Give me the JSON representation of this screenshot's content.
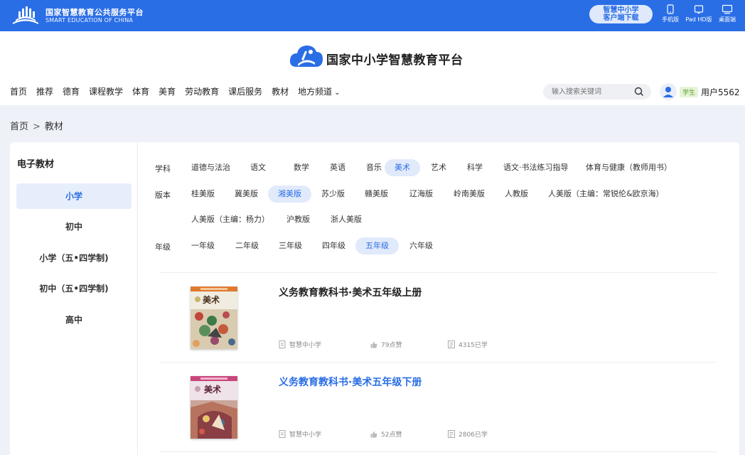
{
  "topbar": {
    "brand_cn": "国家智慧教育公共服务平台",
    "brand_en": "SMART EDUCATION OF CHINA",
    "download_line1": "智慧中小学",
    "download_line2": "客户端下载",
    "devices": [
      {
        "label": "手机版",
        "icon": "mobile-icon"
      },
      {
        "label": "Pad HD版",
        "icon": "tablet-icon"
      },
      {
        "label": "桌面端",
        "icon": "desktop-icon"
      }
    ]
  },
  "header": {
    "site_title": "国家中小学智慧教育平台",
    "nav": [
      "首页",
      "推荐",
      "德育",
      "课程教学",
      "体育",
      "美育",
      "劳动教育",
      "课后服务",
      "教材",
      "地方频道"
    ],
    "search_placeholder": "输入搜索关键词",
    "user_role": "学生",
    "user_name": "用户5562"
  },
  "breadcrumb": {
    "home": "首页",
    "sep": ">",
    "current": "教材"
  },
  "sidebar": {
    "title": "电子教材",
    "items": [
      "小学",
      "初中",
      "小学（五•四学制)",
      "初中（五•四学制)",
      "高中"
    ],
    "active_index": 0
  },
  "filters": {
    "subject": {
      "label": "学科",
      "options": [
        "道德与法治",
        "语文",
        "数学",
        "英语",
        "音乐",
        "美术",
        "艺术",
        "科学",
        "语文·书法练习指导",
        "体育与健康（教师用书）"
      ],
      "selected": "美术"
    },
    "edition": {
      "label": "版本",
      "options": [
        "桂美版",
        "冀美版",
        "湘美版",
        "苏少版",
        "赣美版",
        "辽海版",
        "岭南美版",
        "人教版",
        "人美版（主编：常锐伦&欧京海）",
        "人美版（主编：杨力）",
        "沪教版",
        "浙人美版"
      ],
      "selected": "湘美版"
    },
    "grade": {
      "label": "年级",
      "options": [
        "一年级",
        "二年级",
        "三年级",
        "四年级",
        "五年级",
        "六年级"
      ],
      "selected": "五年级"
    }
  },
  "books": [
    {
      "title": "义务教育教科书·美术五年级上册",
      "publisher": "智慧中小学",
      "likes": "79点赞",
      "learners": "4315已学",
      "cover_text": "美术",
      "highlighted": false
    },
    {
      "title": "义务教育教科书·美术五年级下册",
      "publisher": "智慧中小学",
      "likes": "52点赞",
      "learners": "2806已学",
      "cover_text": "美术",
      "highlighted": true
    }
  ],
  "colors": {
    "brand_blue": "#2a6ee6",
    "page_bg": "#eef1f8",
    "chip_active_bg": "#e1eafb",
    "role_badge": "#5aa02c"
  }
}
